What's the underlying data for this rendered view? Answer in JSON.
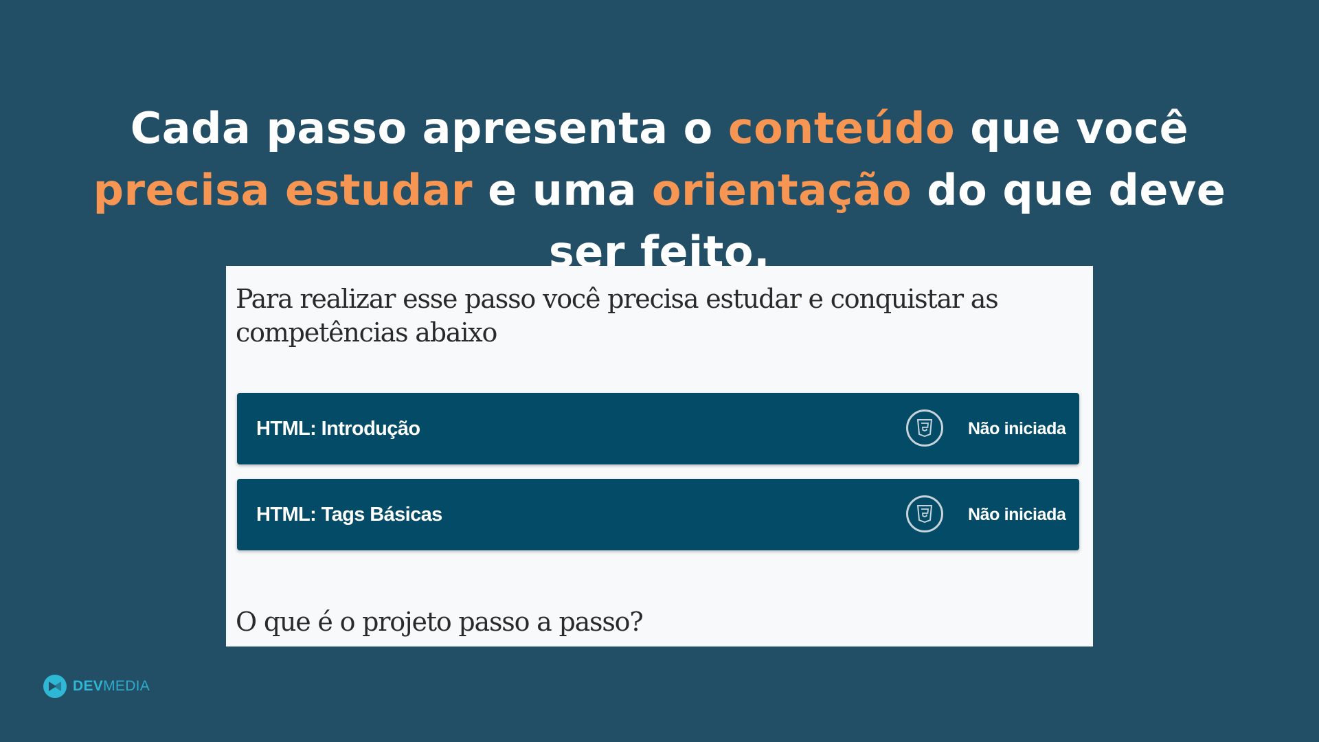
{
  "headline": {
    "segments": [
      {
        "text": "Cada passo apresenta o ",
        "highlight": false
      },
      {
        "text": "conteúdo",
        "highlight": true
      },
      {
        "text": " que você ",
        "highlight": false
      },
      {
        "text": "precisa estudar",
        "highlight": true
      },
      {
        "text": " e uma ",
        "highlight": false
      },
      {
        "text": "orientação",
        "highlight": true
      },
      {
        "text": " do que deve ser feito.",
        "highlight": false
      }
    ]
  },
  "panel": {
    "intro": "Para realizar esse passo você precisa estudar e conquistar as competências abaixo",
    "skills": [
      {
        "title": "HTML: Introdução",
        "status": "Não iniciada",
        "icon": "html5-icon"
      },
      {
        "title": "HTML: Tags Básicas",
        "status": "Não iniciada",
        "icon": "html5-icon"
      }
    ],
    "question": "O que é o projeto passo a passo?"
  },
  "brand": {
    "name_bold": "DEV",
    "name_light": "MEDIA"
  },
  "colors": {
    "background": "#224e66",
    "highlight": "#f79552",
    "card": "#034b66",
    "panel": "#f7f9fb",
    "brand": "#2fb7d6"
  }
}
